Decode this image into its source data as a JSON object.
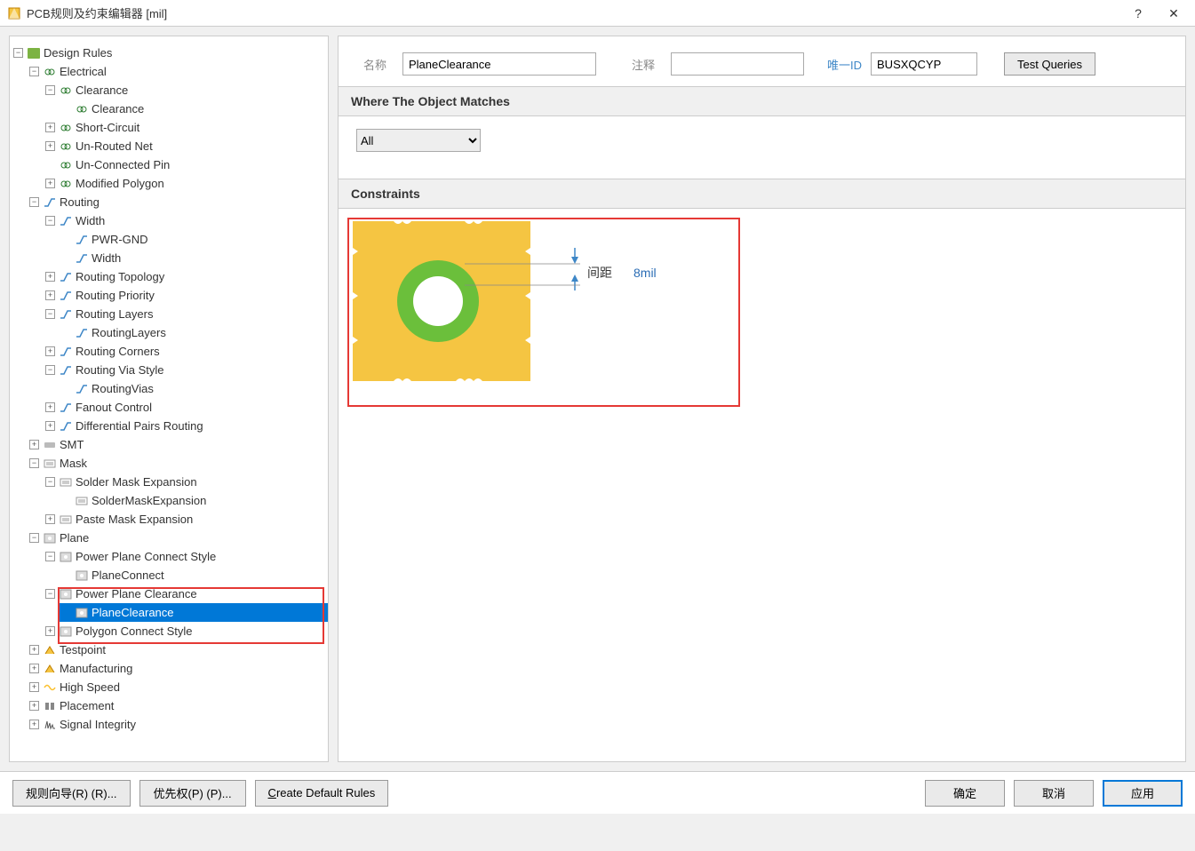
{
  "window": {
    "title": "PCB规则及约束编辑器 [mil]"
  },
  "form": {
    "name_label": "名称",
    "name_value": "PlaneClearance",
    "comment_label": "注释",
    "comment_value": "",
    "id_label": "唯一ID",
    "id_value": "BUSXQCYP",
    "test_queries": "Test Queries"
  },
  "sections": {
    "where": "Where The Object Matches",
    "constraints": "Constraints",
    "scope_selected": "All"
  },
  "constraint": {
    "label": "间距",
    "value": "8mil"
  },
  "buttons": {
    "wizard": "规则向导(R) (R)...",
    "priority": "优先权(P) (P)...",
    "create_default": "Create Default Rules",
    "ok": "确定",
    "cancel": "取消",
    "apply": "应用"
  },
  "tree": {
    "root": "Design Rules",
    "electrical": "Electrical",
    "clearance_cat": "Clearance",
    "clearance": "Clearance",
    "short": "Short-Circuit",
    "unrouted": "Un-Routed Net",
    "unconnected": "Un-Connected Pin",
    "modpoly": "Modified Polygon",
    "routing": "Routing",
    "width_cat": "Width",
    "pwrgnd": "PWR-GND",
    "width": "Width",
    "topo": "Routing Topology",
    "prio": "Routing Priority",
    "layers_cat": "Routing Layers",
    "layers": "RoutingLayers",
    "corners": "Routing Corners",
    "via_cat": "Routing Via Style",
    "vias": "RoutingVias",
    "fanout": "Fanout Control",
    "diff": "Differential Pairs Routing",
    "smt": "SMT",
    "mask": "Mask",
    "solder_cat": "Solder Mask Expansion",
    "solder": "SolderMaskExpansion",
    "paste": "Paste Mask Expansion",
    "plane": "Plane",
    "ppconnect_cat": "Power Plane Connect Style",
    "ppconnect": "PlaneConnect",
    "ppclear_cat": "Power Plane Clearance",
    "ppclear": "PlaneClearance",
    "polyconnect": "Polygon Connect Style",
    "testpoint": "Testpoint",
    "mfg": "Manufacturing",
    "hispeed": "High Speed",
    "placement": "Placement",
    "si": "Signal Integrity"
  }
}
